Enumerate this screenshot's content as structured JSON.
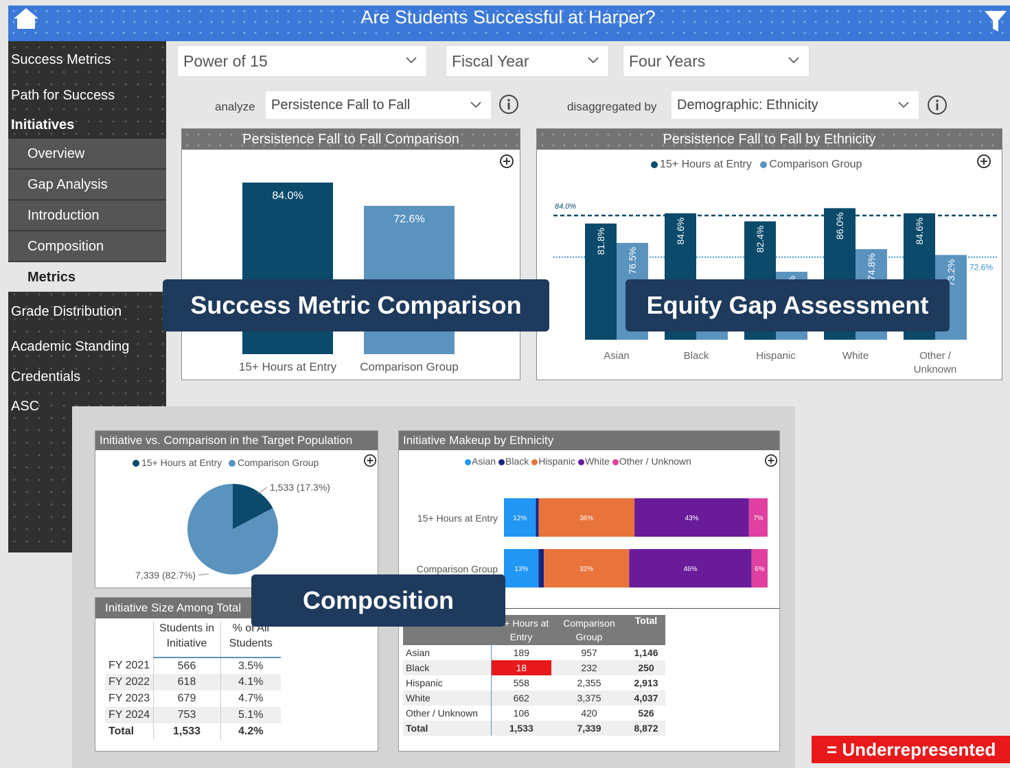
{
  "header": {
    "title": "Are Students Successful at Harper?"
  },
  "sidebar": {
    "items": [
      "Success Metrics",
      "Path for Success",
      "Initiatives"
    ],
    "sub_items": [
      "Overview",
      "Gap Analysis",
      "Introduction",
      "Composition",
      "Metrics"
    ],
    "items_lower": [
      "Grade Distribution",
      "Academic Standing",
      "Credentials",
      "ASC"
    ]
  },
  "filters": {
    "initiative": "Power of 15",
    "year_type": "Fiscal Year",
    "range": "Four Years",
    "analyze_label": "analyze",
    "analyze_value": "Persistence Fall to Fall",
    "disagg_label": "disaggregated by",
    "disagg_value": "Demographic: Ethnicity"
  },
  "comparison_panel": {
    "title": "Persistence Fall to Fall Comparison",
    "chart_data": {
      "type": "bar",
      "categories": [
        "15+ Hours at Entry",
        "Comparison Group"
      ],
      "values": [
        84.0,
        72.6
      ],
      "value_labels": [
        "84.0%",
        "72.6%"
      ],
      "colors": [
        "#0b4a6b",
        "#5b93bf"
      ]
    }
  },
  "ethnicity_panel": {
    "title": "Persistence Fall to Fall by Ethnicity",
    "legend": [
      "15+ Hours at Entry",
      "Comparison Group"
    ],
    "ref_lines": [
      "84.0%",
      "72.6%"
    ],
    "chart_data": {
      "type": "bar",
      "categories": [
        "Asian",
        "Black",
        "Hispanic",
        "White",
        "Other / Unknown"
      ],
      "series": [
        {
          "name": "15+ Hours at Entry",
          "values": [
            81.8,
            84.6,
            82.4,
            86.0,
            84.6
          ],
          "labels": [
            "81.8%",
            "84.6%",
            "82.4%",
            "86.0%",
            "84.6%"
          ]
        },
        {
          "name": "Comparison Group",
          "values": [
            76.5,
            63.0,
            68.6,
            74.8,
            73.2
          ],
          "labels": [
            "76.5%",
            "63.0%",
            "68.6%",
            "74.8%",
            "73.2%"
          ]
        }
      ],
      "reference_values": [
        84.0,
        72.6
      ]
    }
  },
  "callouts": {
    "success": "Success Metric Comparison",
    "equity": "Equity Gap Assessment",
    "composition": "Composition"
  },
  "pie_panel": {
    "title": "Initiative vs. Comparison in the Target Population",
    "legend": [
      "15+ Hours at Entry",
      "Comparison Group"
    ],
    "chart_data": {
      "type": "pie",
      "labels": [
        "15+ Hours at Entry",
        "Comparison Group"
      ],
      "values": [
        1533,
        7339
      ],
      "value_labels": [
        "1,533 (17.3%)",
        "7,339 (82.7%)"
      ]
    }
  },
  "makeup_panel": {
    "title": "Initiative Makeup by Ethnicity",
    "legend": [
      "Asian",
      "Black",
      "Hispanic",
      "White",
      "Other / Unknown"
    ],
    "colors": [
      "#2196f3",
      "#1a237e",
      "#e8743b",
      "#6a1b9a",
      "#e040a0"
    ],
    "chart_data": {
      "type": "bar",
      "stacked": true,
      "categories": [
        "15+ Hours at Entry",
        "Comparison Group"
      ],
      "series": [
        {
          "name": "Asian",
          "values": [
            12,
            13
          ]
        },
        {
          "name": "Black",
          "values": [
            1,
            2
          ]
        },
        {
          "name": "Hispanic",
          "values": [
            36,
            32
          ]
        },
        {
          "name": "White",
          "values": [
            43,
            46
          ]
        },
        {
          "name": "Other / Unknown",
          "values": [
            7,
            6
          ]
        }
      ],
      "shown_labels": [
        [
          "12%",
          "",
          "36%",
          "43%",
          "7%"
        ],
        [
          "13%",
          "",
          "32%",
          "46%",
          "6%"
        ]
      ]
    }
  },
  "size_panel": {
    "title": "Initiative Size Among Total",
    "headers": [
      "",
      "Students in Initiative",
      "% of All Students"
    ],
    "rows": [
      [
        "FY 2021",
        "566",
        "3.5%"
      ],
      [
        "FY 2022",
        "618",
        "4.1%"
      ],
      [
        "FY 2023",
        "679",
        "4.7%"
      ],
      [
        "FY 2024",
        "753",
        "5.1%"
      ]
    ],
    "total": [
      "Total",
      "1,533",
      "4.2%"
    ]
  },
  "count_table": {
    "headers": [
      "",
      "15+ Hours at Entry",
      "Comparison Group",
      "Total"
    ],
    "rows": [
      [
        "Asian",
        "189",
        "957",
        "1,146"
      ],
      [
        "Black",
        "18",
        "232",
        "250"
      ],
      [
        "Hispanic",
        "558",
        "2,355",
        "2,913"
      ],
      [
        "White",
        "662",
        "3,375",
        "4,037"
      ],
      [
        "Other / Unknown",
        "106",
        "420",
        "526"
      ]
    ],
    "total": [
      "Total",
      "1,533",
      "7,339",
      "8,872"
    ]
  },
  "underrepresented_label": "= Underrepresented",
  "colors": {
    "initiative": "#0b4a6b",
    "comparison": "#5b93bf",
    "header": "#3b78d8",
    "highlight": "#e8191b"
  }
}
